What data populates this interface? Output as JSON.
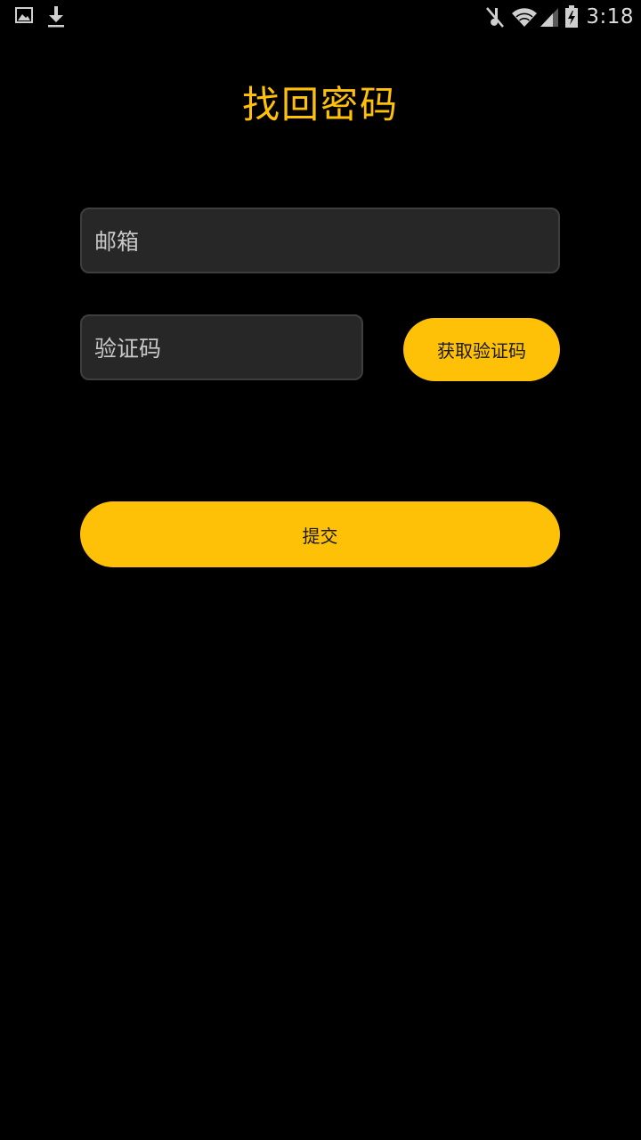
{
  "status_bar": {
    "time": "3:18",
    "left_icons": [
      "image-icon",
      "download-icon"
    ],
    "right_icons": [
      "mute-icon",
      "wifi-icon",
      "signal-icon",
      "battery-charging-icon"
    ]
  },
  "page": {
    "title": "找回密码"
  },
  "form": {
    "email_placeholder": "邮箱",
    "code_placeholder": "验证码",
    "get_code_label": "获取验证码",
    "submit_label": "提交"
  },
  "colors": {
    "accent": "#ffc107",
    "background": "#000000",
    "field_background": "#272727"
  }
}
